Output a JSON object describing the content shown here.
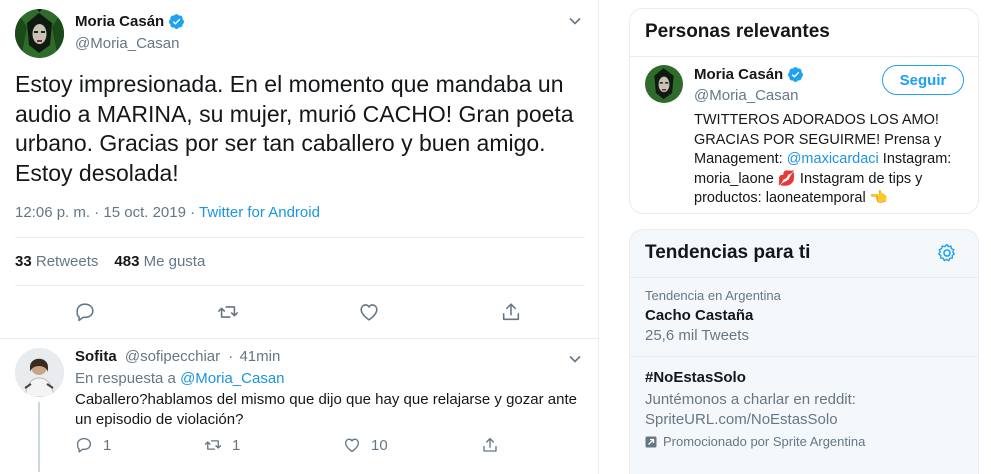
{
  "tweet": {
    "author_name": "Moria Casán",
    "author_handle": "@Moria_Casan",
    "text": "Estoy impresionada. En el momento que mandaba un audio a MARINA, su mujer, murió CACHO! Gran poeta urbano. Gracias por ser tan caballero y buen amigo. Estoy desolada!",
    "time": "12:06 p. m.",
    "date": "15 oct. 2019",
    "separator": "·",
    "source": "Twitter for Android",
    "retweets_count": "33",
    "retweets_label": "Retweets",
    "likes_count": "483",
    "likes_label": "Me gusta"
  },
  "reply": {
    "author_name": "Sofita",
    "author_handle": "@sofipecchiar",
    "separator": "·",
    "age": "41min",
    "in_reply_prefix": "En respuesta a",
    "in_reply_handle": "@Moria_Casan",
    "text": "Caballero?hablamos del mismo que dijo que hay que relajarse y gozar ante un episodio de violación?",
    "replies": "1",
    "retweets": "1",
    "likes": "10"
  },
  "relevant": {
    "title": "Personas relevantes",
    "name": "Moria Casán",
    "handle": "@Moria_Casan",
    "follow_label": "Seguir",
    "bio_part1": "TWITTEROS ADORADOS LOS AMO! GRACIAS POR SEGUIRME! Prensa y Management: ",
    "bio_mention": "@maxicardaci",
    "bio_part2": " Instagram: moria_laone 💋 Instagram de tips y productos: laoneatemporal 👈"
  },
  "trends": {
    "title": "Tendencias para ti",
    "items": [
      {
        "context": "Tendencia en Argentina",
        "name": "Cacho Castaña",
        "count": "25,6 mil Tweets"
      }
    ],
    "promoted": {
      "name": "#NoEstasSolo",
      "description": "Juntémonos a charlar en reddit: SpriteURL.com/NoEstasSolo",
      "by": "Promocionado por Sprite Argentina"
    }
  },
  "colors": {
    "accent": "#1da1f2",
    "link": "#1b95e0",
    "secondary_text": "#657786",
    "border": "#e6ecf0",
    "verified": "#1da1f2"
  },
  "icons": [
    "verified-badge-icon",
    "chevron-down-icon",
    "reply-icon",
    "retweet-icon",
    "like-icon",
    "share-icon",
    "gear-icon",
    "promoted-icon"
  ]
}
